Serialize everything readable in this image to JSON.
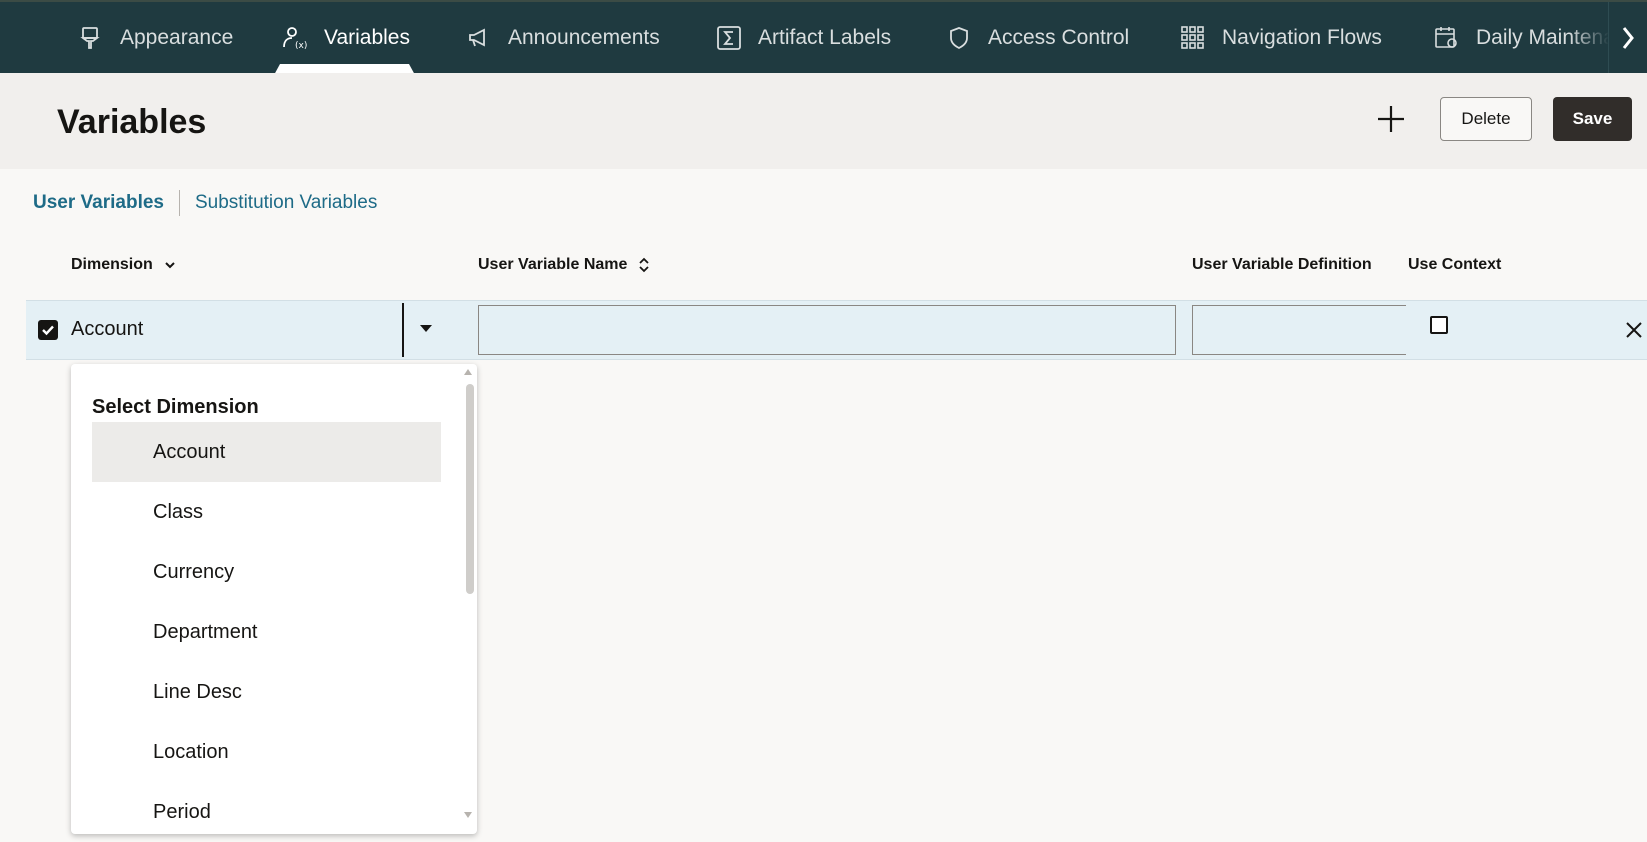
{
  "topnav": {
    "tabs": [
      {
        "label": "Appearance",
        "icon": "brush-icon"
      },
      {
        "label": "Variables",
        "icon": "user-variable-icon",
        "active": true
      },
      {
        "label": "Announcements",
        "icon": "megaphone-icon"
      },
      {
        "label": "Artifact Labels",
        "icon": "sigma-icon"
      },
      {
        "label": "Access Control",
        "icon": "shield-icon"
      },
      {
        "label": "Navigation Flows",
        "icon": "grid-icon"
      },
      {
        "label": "Daily Maintena",
        "icon": "calendar-gear-icon"
      }
    ]
  },
  "header": {
    "title": "Variables",
    "delete_label": "Delete",
    "save_label": "Save"
  },
  "subtabs": {
    "user_variables": "User Variables",
    "substitution_variables": "Substitution Variables"
  },
  "table": {
    "columns": {
      "dimension": "Dimension",
      "name": "User Variable Name",
      "definition": "User Variable Definition",
      "use_context": "Use Context"
    },
    "row": {
      "dimension": "Account",
      "name": "",
      "definition": "",
      "checked": true,
      "use_context": false
    }
  },
  "dropdown": {
    "title": "Select Dimension",
    "items": [
      "Account",
      "Class",
      "Currency",
      "Department",
      "Line Desc",
      "Location",
      "Period"
    ],
    "selected": "Account"
  },
  "colors": {
    "nav_bg": "#1f3a40",
    "link": "#1e6b87",
    "row_highlight": "#e4f0f5",
    "primary_button": "#312d2a"
  }
}
